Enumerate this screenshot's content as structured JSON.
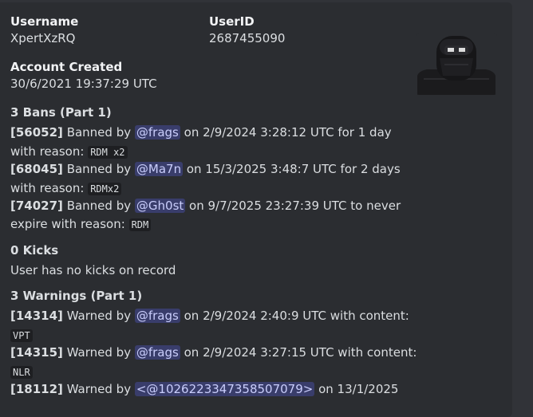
{
  "username": {
    "label": "Username",
    "value": "XpertXzRQ"
  },
  "userid": {
    "label": "UserID",
    "value": "2687455090"
  },
  "created": {
    "label": "Account Created",
    "value": "30/6/2021 19:37:29 UTC"
  },
  "bans": {
    "header": "3 Bans (Part 1)",
    "items": [
      {
        "id": "[56052]",
        "pre": "Banned by",
        "mod": "@frags",
        "mid": "on 2/9/2024 3:28:12 UTC for 1 day",
        "cont": "with reason:",
        "reason": "RDM x2"
      },
      {
        "id": "[68045]",
        "pre": "Banned by",
        "mod": "@Ma7n",
        "mid": "on 15/3/2025 3:48:7 UTC for 2 days",
        "cont": "with reason:",
        "reason": "RDMx2"
      },
      {
        "id": "[74027]",
        "pre": "Banned by",
        "mod": "@Gh0st",
        "mid": "on 9/7/2025 23:27:39 UTC to never",
        "cont": "expire with reason:",
        "reason": "RDM"
      }
    ]
  },
  "kicks": {
    "header": "0 Kicks",
    "text": "User has no kicks on record"
  },
  "warnings": {
    "header": "3 Warnings (Part 1)",
    "items": [
      {
        "id": "[14314]",
        "pre": "Warned by",
        "mod": "@frags",
        "mid": "on 2/9/2024 2:40:9 UTC with content:",
        "content": "VPT"
      },
      {
        "id": "[14315]",
        "pre": "Warned by",
        "mod": "@frags",
        "mid": "on 2/9/2024 3:27:15 UTC with content:",
        "content": "NLR"
      },
      {
        "id": "[18112]",
        "pre": "Warned by",
        "mod": "<@1026223347358507079>",
        "mid": "on 13/1/2025"
      }
    ]
  },
  "icons": {
    "avatar": "roblox-avatar-thumbnail"
  },
  "colors": {
    "embed_bg": "#2b2d31",
    "page_bg": "#313338",
    "mention_bg": "#3c4270",
    "mention_text": "#c9cdfb"
  }
}
